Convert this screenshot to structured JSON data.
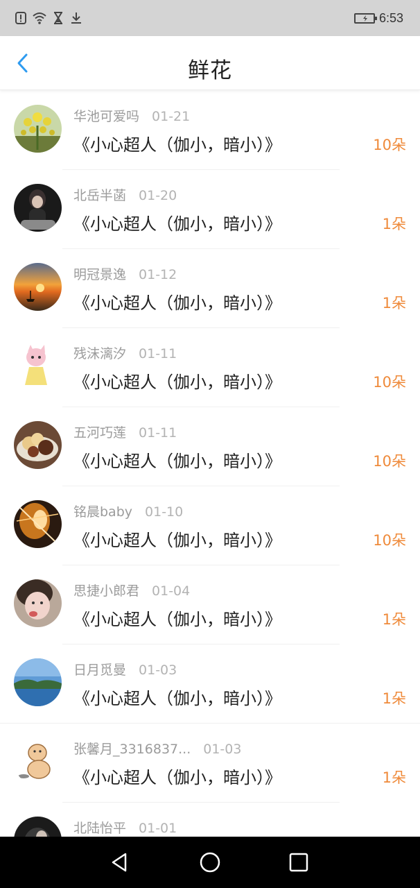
{
  "status_bar": {
    "time": "6:53",
    "icons": [
      "alert-icon",
      "wifi-icon",
      "hourglass-icon",
      "download-icon",
      "battery-charging-icon"
    ]
  },
  "header": {
    "title": "鲜花",
    "back_icon": "chevron-left-icon",
    "accent_color": "#2e9bf0"
  },
  "colors": {
    "count": "#ef8a3a",
    "name": "#9b9b9b"
  },
  "items": [
    {
      "name": "华池可爱吗",
      "date": "01-21",
      "work": "《小心超人（伽小，暗小）》",
      "count": "10朵"
    },
    {
      "name": "北岳半菡",
      "date": "01-20",
      "work": "《小心超人（伽小，暗小）》",
      "count": "1朵"
    },
    {
      "name": "明冠景逸",
      "date": "01-12",
      "work": "《小心超人（伽小，暗小）》",
      "count": "1朵"
    },
    {
      "name": "残沫漓汐",
      "date": "01-11",
      "work": "《小心超人（伽小，暗小）》",
      "count": "10朵"
    },
    {
      "name": "五河巧莲",
      "date": "01-11",
      "work": "《小心超人（伽小，暗小）》",
      "count": "10朵"
    },
    {
      "name": "铭晨baby",
      "date": "01-10",
      "work": "《小心超人（伽小，暗小）》",
      "count": "10朵"
    },
    {
      "name": "思捷小郎君",
      "date": "01-04",
      "work": "《小心超人（伽小，暗小）》",
      "count": "1朵"
    },
    {
      "name": "日月觅曼",
      "date": "01-03",
      "work": "《小心超人（伽小，暗小）》",
      "count": "1朵"
    },
    {
      "name": "张馨月_3316837...",
      "date": "01-03",
      "work": "《小心超人（伽小，暗小）》",
      "count": "1朵"
    },
    {
      "name": "北陆怡平",
      "date": "01-01"
    }
  ],
  "system_nav": {
    "buttons": [
      "back-triangle-icon",
      "home-circle-icon",
      "recents-square-icon"
    ]
  }
}
